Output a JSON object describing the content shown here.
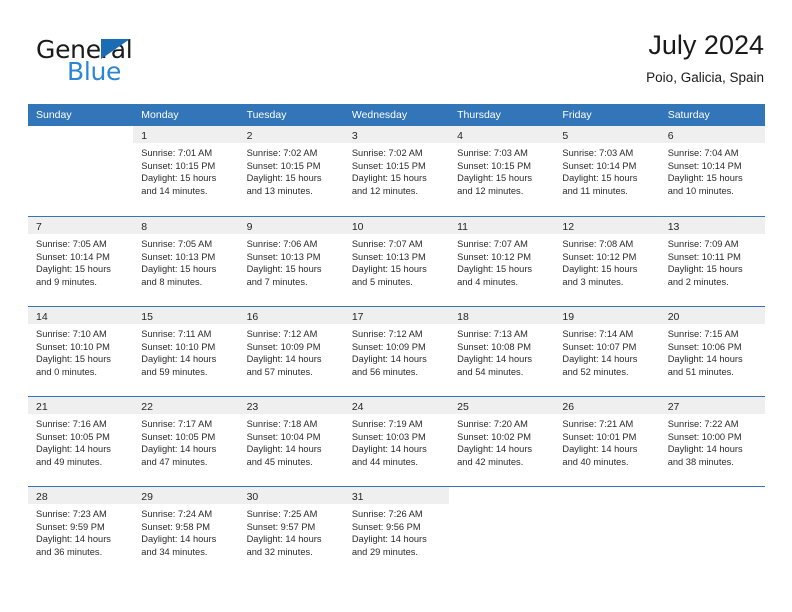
{
  "brand": {
    "word_one": "General",
    "word_two": "Blue",
    "triangle_icon": "triangle-icon",
    "accent_blue": "#2b87d4",
    "triangle_blue": "#1a6cb3"
  },
  "header": {
    "month_title": "July 2024",
    "location": "Poio, Galicia, Spain"
  },
  "calendar": {
    "header_bg": "#3275b8",
    "daynum_band_bg": "#efefef",
    "weekdays": [
      "Sunday",
      "Monday",
      "Tuesday",
      "Wednesday",
      "Thursday",
      "Friday",
      "Saturday"
    ],
    "weeks": [
      [
        {
          "day": "",
          "lines": []
        },
        {
          "day": "1",
          "lines": [
            "Sunrise: 7:01 AM",
            "Sunset: 10:15 PM",
            "Daylight: 15 hours",
            "and 14 minutes."
          ]
        },
        {
          "day": "2",
          "lines": [
            "Sunrise: 7:02 AM",
            "Sunset: 10:15 PM",
            "Daylight: 15 hours",
            "and 13 minutes."
          ]
        },
        {
          "day": "3",
          "lines": [
            "Sunrise: 7:02 AM",
            "Sunset: 10:15 PM",
            "Daylight: 15 hours",
            "and 12 minutes."
          ]
        },
        {
          "day": "4",
          "lines": [
            "Sunrise: 7:03 AM",
            "Sunset: 10:15 PM",
            "Daylight: 15 hours",
            "and 12 minutes."
          ]
        },
        {
          "day": "5",
          "lines": [
            "Sunrise: 7:03 AM",
            "Sunset: 10:14 PM",
            "Daylight: 15 hours",
            "and 11 minutes."
          ]
        },
        {
          "day": "6",
          "lines": [
            "Sunrise: 7:04 AM",
            "Sunset: 10:14 PM",
            "Daylight: 15 hours",
            "and 10 minutes."
          ]
        }
      ],
      [
        {
          "day": "7",
          "lines": [
            "Sunrise: 7:05 AM",
            "Sunset: 10:14 PM",
            "Daylight: 15 hours",
            "and 9 minutes."
          ]
        },
        {
          "day": "8",
          "lines": [
            "Sunrise: 7:05 AM",
            "Sunset: 10:13 PM",
            "Daylight: 15 hours",
            "and 8 minutes."
          ]
        },
        {
          "day": "9",
          "lines": [
            "Sunrise: 7:06 AM",
            "Sunset: 10:13 PM",
            "Daylight: 15 hours",
            "and 7 minutes."
          ]
        },
        {
          "day": "10",
          "lines": [
            "Sunrise: 7:07 AM",
            "Sunset: 10:13 PM",
            "Daylight: 15 hours",
            "and 5 minutes."
          ]
        },
        {
          "day": "11",
          "lines": [
            "Sunrise: 7:07 AM",
            "Sunset: 10:12 PM",
            "Daylight: 15 hours",
            "and 4 minutes."
          ]
        },
        {
          "day": "12",
          "lines": [
            "Sunrise: 7:08 AM",
            "Sunset: 10:12 PM",
            "Daylight: 15 hours",
            "and 3 minutes."
          ]
        },
        {
          "day": "13",
          "lines": [
            "Sunrise: 7:09 AM",
            "Sunset: 10:11 PM",
            "Daylight: 15 hours",
            "and 2 minutes."
          ]
        }
      ],
      [
        {
          "day": "14",
          "lines": [
            "Sunrise: 7:10 AM",
            "Sunset: 10:10 PM",
            "Daylight: 15 hours",
            "and 0 minutes."
          ]
        },
        {
          "day": "15",
          "lines": [
            "Sunrise: 7:11 AM",
            "Sunset: 10:10 PM",
            "Daylight: 14 hours",
            "and 59 minutes."
          ]
        },
        {
          "day": "16",
          "lines": [
            "Sunrise: 7:12 AM",
            "Sunset: 10:09 PM",
            "Daylight: 14 hours",
            "and 57 minutes."
          ]
        },
        {
          "day": "17",
          "lines": [
            "Sunrise: 7:12 AM",
            "Sunset: 10:09 PM",
            "Daylight: 14 hours",
            "and 56 minutes."
          ]
        },
        {
          "day": "18",
          "lines": [
            "Sunrise: 7:13 AM",
            "Sunset: 10:08 PM",
            "Daylight: 14 hours",
            "and 54 minutes."
          ]
        },
        {
          "day": "19",
          "lines": [
            "Sunrise: 7:14 AM",
            "Sunset: 10:07 PM",
            "Daylight: 14 hours",
            "and 52 minutes."
          ]
        },
        {
          "day": "20",
          "lines": [
            "Sunrise: 7:15 AM",
            "Sunset: 10:06 PM",
            "Daylight: 14 hours",
            "and 51 minutes."
          ]
        }
      ],
      [
        {
          "day": "21",
          "lines": [
            "Sunrise: 7:16 AM",
            "Sunset: 10:05 PM",
            "Daylight: 14 hours",
            "and 49 minutes."
          ]
        },
        {
          "day": "22",
          "lines": [
            "Sunrise: 7:17 AM",
            "Sunset: 10:05 PM",
            "Daylight: 14 hours",
            "and 47 minutes."
          ]
        },
        {
          "day": "23",
          "lines": [
            "Sunrise: 7:18 AM",
            "Sunset: 10:04 PM",
            "Daylight: 14 hours",
            "and 45 minutes."
          ]
        },
        {
          "day": "24",
          "lines": [
            "Sunrise: 7:19 AM",
            "Sunset: 10:03 PM",
            "Daylight: 14 hours",
            "and 44 minutes."
          ]
        },
        {
          "day": "25",
          "lines": [
            "Sunrise: 7:20 AM",
            "Sunset: 10:02 PM",
            "Daylight: 14 hours",
            "and 42 minutes."
          ]
        },
        {
          "day": "26",
          "lines": [
            "Sunrise: 7:21 AM",
            "Sunset: 10:01 PM",
            "Daylight: 14 hours",
            "and 40 minutes."
          ]
        },
        {
          "day": "27",
          "lines": [
            "Sunrise: 7:22 AM",
            "Sunset: 10:00 PM",
            "Daylight: 14 hours",
            "and 38 minutes."
          ]
        }
      ],
      [
        {
          "day": "28",
          "lines": [
            "Sunrise: 7:23 AM",
            "Sunset: 9:59 PM",
            "Daylight: 14 hours",
            "and 36 minutes."
          ]
        },
        {
          "day": "29",
          "lines": [
            "Sunrise: 7:24 AM",
            "Sunset: 9:58 PM",
            "Daylight: 14 hours",
            "and 34 minutes."
          ]
        },
        {
          "day": "30",
          "lines": [
            "Sunrise: 7:25 AM",
            "Sunset: 9:57 PM",
            "Daylight: 14 hours",
            "and 32 minutes."
          ]
        },
        {
          "day": "31",
          "lines": [
            "Sunrise: 7:26 AM",
            "Sunset: 9:56 PM",
            "Daylight: 14 hours",
            "and 29 minutes."
          ]
        },
        {
          "day": "",
          "lines": []
        },
        {
          "day": "",
          "lines": []
        },
        {
          "day": "",
          "lines": []
        }
      ]
    ]
  }
}
